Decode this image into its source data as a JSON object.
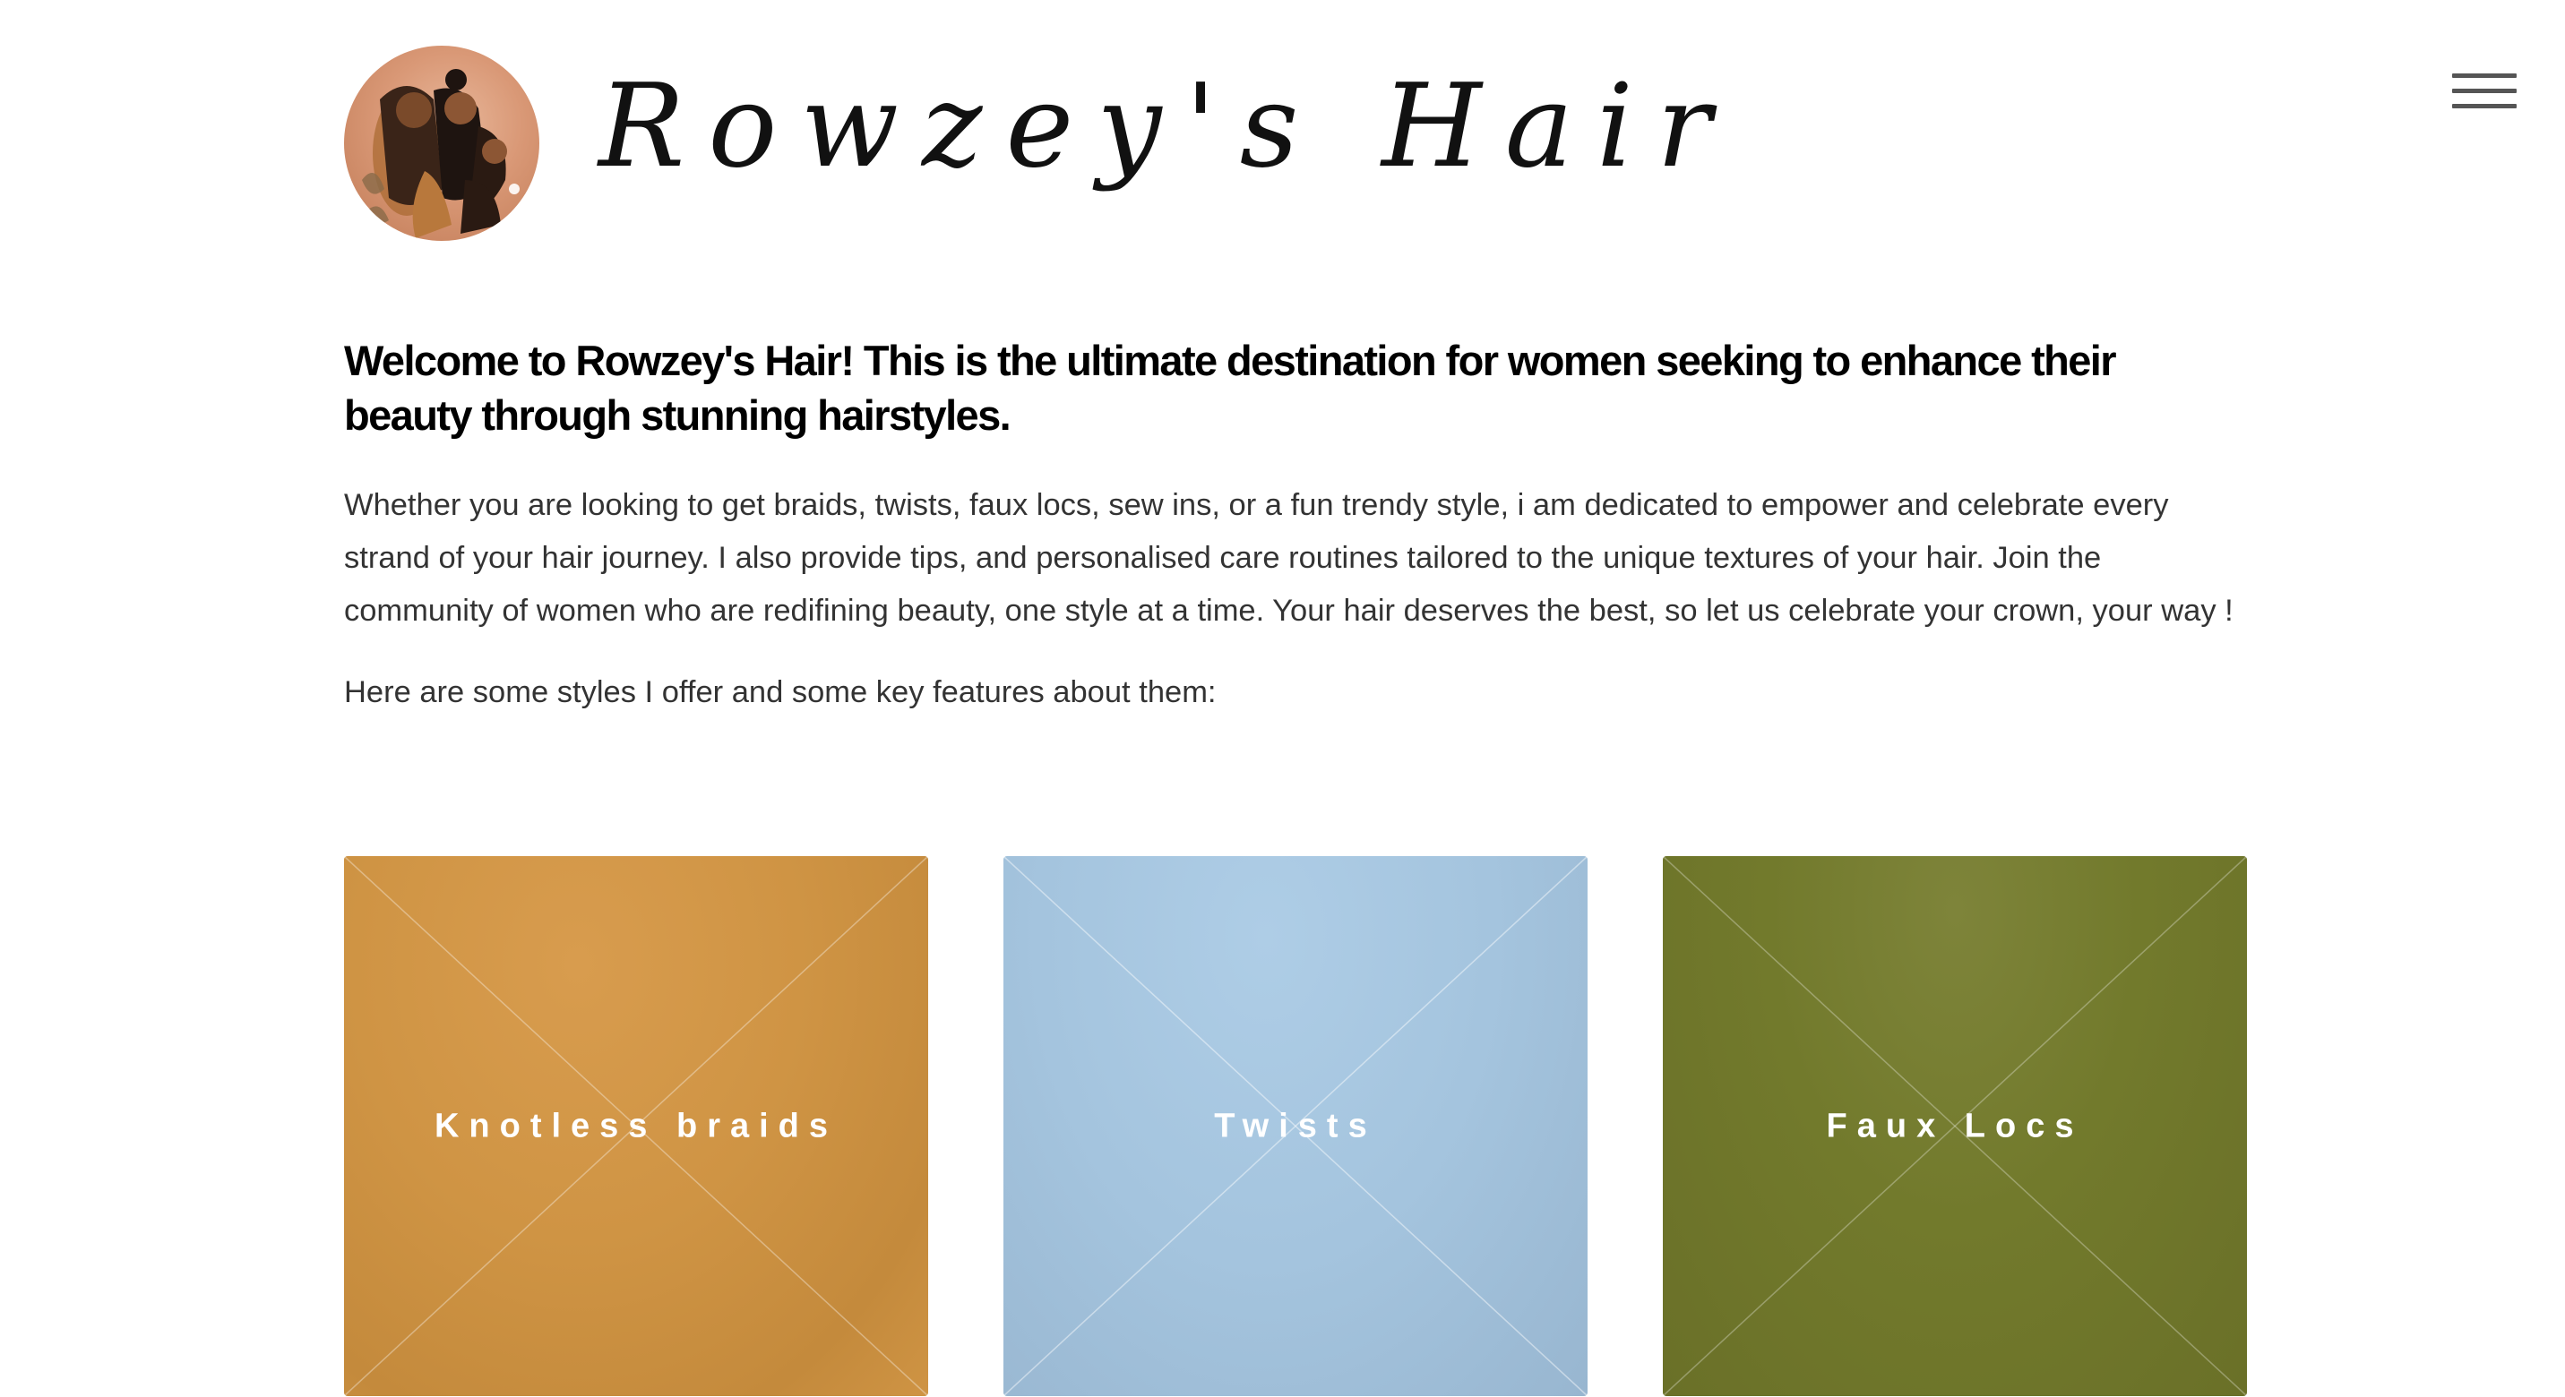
{
  "header": {
    "site_title": "Rowzey's Hair",
    "logo_icon": "logo-illustration",
    "menu_icon": "hamburger-menu-icon"
  },
  "intro": {
    "headline": "Welcome to Rowzey's Hair! This is the ultimate destination for women seeking to enhance their beauty through stunning hairstyles.",
    "description": "Whether you are looking to get braids, twists, faux locs, sew ins, or a fun trendy style, i am dedicated to empower and celebrate every strand of your hair journey. I also provide tips, and personalised care routines tailored to the unique textures of your hair. Join the community of women who are redifining beauty, one style at a time. Your hair deserves the best, so let us celebrate your crown, your way !",
    "styles_intro": "Here are some styles I offer and some key features about them:"
  },
  "cards": [
    {
      "label": "Knotless braids",
      "color": "#cf9444"
    },
    {
      "label": "Twists",
      "color": "#a4c4de"
    },
    {
      "label": "Faux Locs",
      "color": "#727a2c"
    }
  ],
  "colors": {
    "background": "#ffffff",
    "headline": "#000000",
    "body_text": "#333333",
    "menu_icon": "#555555"
  }
}
